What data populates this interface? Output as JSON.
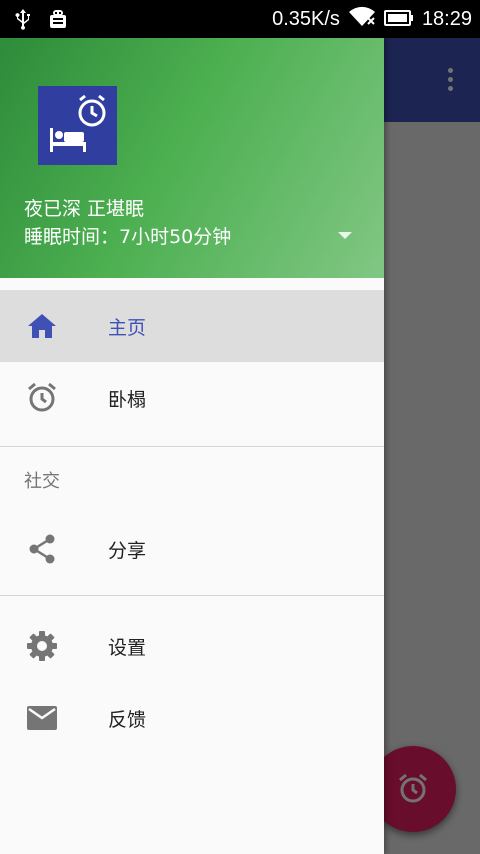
{
  "status_bar": {
    "speed": "0.35K/s",
    "time": "18:29"
  },
  "drawer": {
    "header": {
      "title": "夜已深 正堪眠",
      "subtitle": "睡眠时间：7小时50分钟"
    },
    "items": [
      {
        "label": "主页",
        "icon": "home-icon",
        "active": true
      },
      {
        "label": "卧榻",
        "icon": "alarm-icon",
        "active": false
      }
    ],
    "section_label": "社交",
    "social_items": [
      {
        "label": "分享",
        "icon": "share-icon"
      }
    ],
    "bottom_items": [
      {
        "label": "设置",
        "icon": "gear-icon"
      },
      {
        "label": "反馈",
        "icon": "mail-icon"
      }
    ]
  },
  "colors": {
    "primary": "#3f51b5",
    "header_green": "#4caf50",
    "fab": "#e91e63"
  }
}
